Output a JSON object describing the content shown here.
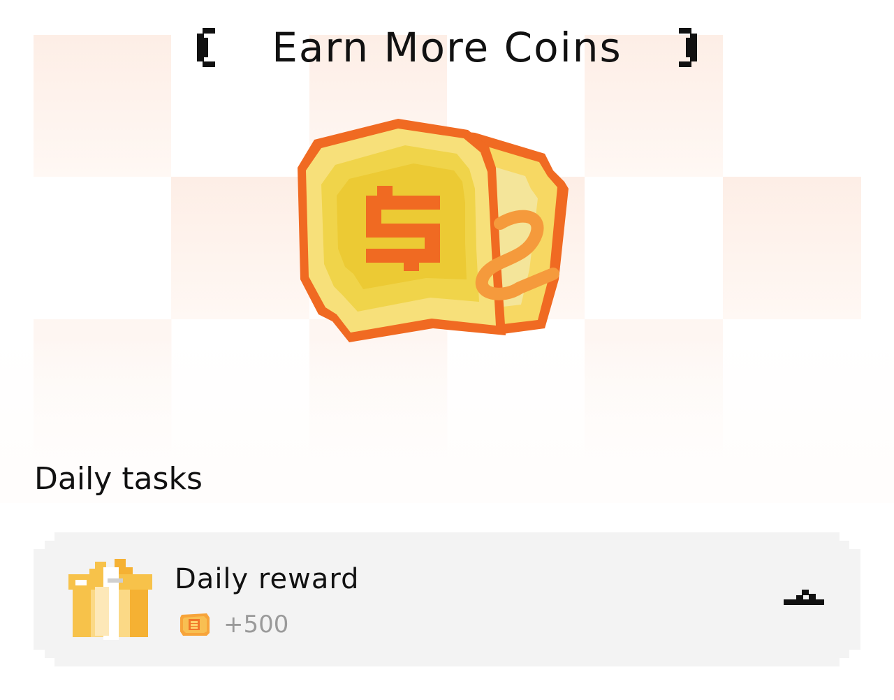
{
  "header": {
    "title": "Earn More Coins"
  },
  "hero": {
    "icon": "coin-stack-icon"
  },
  "section": {
    "title": "Daily tasks"
  },
  "tasks": [
    {
      "name": "Daily reward",
      "reward": "+500",
      "icon": "gift-icon",
      "reward_icon": "coin-icon",
      "action_icon": "claim-icon"
    }
  ],
  "colors": {
    "accent": "#f06a22",
    "coin": "#f3d33c",
    "card_bg": "#f3f3f3",
    "reward_text": "#9a9a9a",
    "checker_light": "#fdeee6",
    "checker_faint": "#fff8f4"
  }
}
